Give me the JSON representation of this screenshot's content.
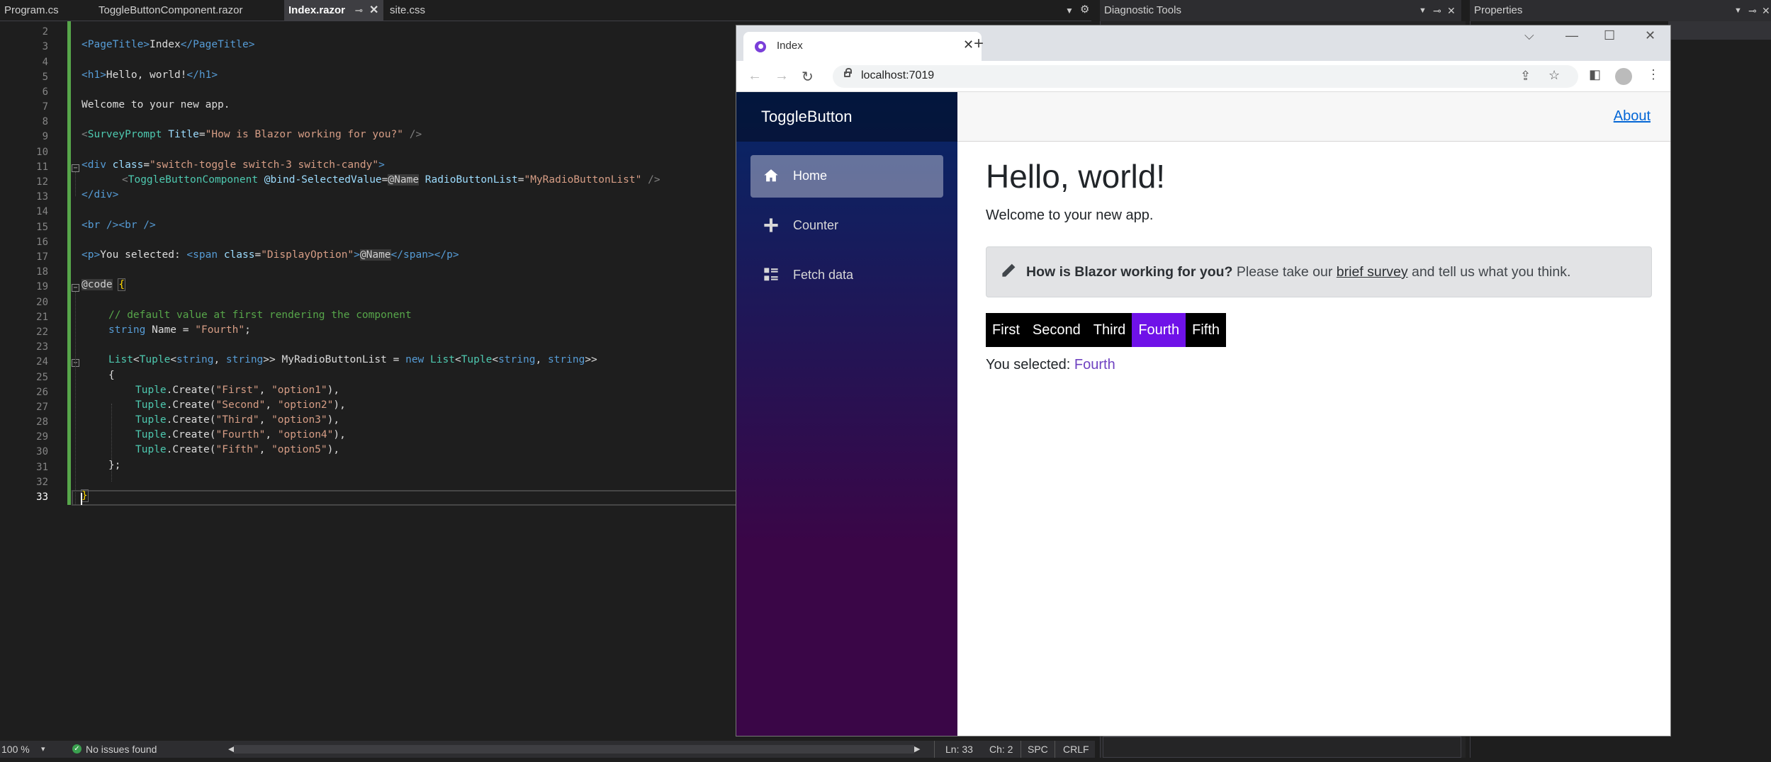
{
  "editor_tabs": [
    {
      "label": "Program.cs",
      "active": false
    },
    {
      "label": "ToggleButtonComponent.razor",
      "active": false
    },
    {
      "label": "Index.razor",
      "active": true
    },
    {
      "label": "site.css",
      "active": false
    }
  ],
  "line_numbers": [
    "2",
    "3",
    "4",
    "5",
    "6",
    "7",
    "8",
    "9",
    "10",
    "11",
    "12",
    "13",
    "14",
    "15",
    "16",
    "17",
    "18",
    "19",
    "20",
    "21",
    "22",
    "23",
    "24",
    "25",
    "26",
    "27",
    "28",
    "29",
    "30",
    "31",
    "32",
    "33"
  ],
  "code": {
    "l3": {
      "tag_open": "<PageTitle>",
      "text": "Index",
      "tag_close": "</PageTitle>"
    },
    "l5": {
      "tag_open": "<h1>",
      "text": "Hello, world!",
      "tag_close": "</h1>"
    },
    "l7": "Welcome to your new app.",
    "l9": {
      "open": "<",
      "comp": "SurveyPrompt",
      "attr": "Title",
      "eq": "=",
      "str": "\"How is Blazor working for you?\"",
      "close": " />"
    },
    "l11": {
      "open": "<div ",
      "attr": "class",
      "eq": "=",
      "str": "\"switch-toggle switch-3 switch-candy\"",
      "close": ">"
    },
    "l12": {
      "open": "<",
      "comp": "ToggleButtonComponent",
      "attr1": "@bind-SelectedValue",
      "eq1": "=",
      "val1": "@Name",
      "attr2": "RadioButtonList",
      "eq2": "=",
      "str2": "\"MyRadioButtonList\"",
      "close": " />"
    },
    "l13": "</div>",
    "l15": "<br /><br />",
    "l17": {
      "p_open": "<p>",
      "text": "You selected: ",
      "span_open": "<span ",
      "attr": "class",
      "eq": "=",
      "str": "\"DisplayOption\"",
      "gt": ">",
      "razor": "@Name",
      "span_close": "</span>",
      "p_close": "</p>"
    },
    "l19": {
      "razor": "@code",
      "brace": "{"
    },
    "l21": "// default value at first rendering the component",
    "l22": {
      "kw": "string",
      "rest": " Name = ",
      "str": "\"Fourth\"",
      "end": ";"
    },
    "l24": {
      "type1": "List",
      "p1": "<",
      "type2": "Tuple",
      "p2": "<",
      "kw1": "string",
      "p3": ", ",
      "kw2": "string",
      "p4": ">> MyRadioButtonList = ",
      "kw3": "new",
      "p5": " ",
      "type3": "List",
      "p6": "<",
      "type4": "Tuple",
      "p7": "<",
      "kw4": "string",
      "p8": ", ",
      "kw5": "string",
      "p9": ">>"
    },
    "l25": "{",
    "tuples": [
      {
        "type": "Tuple",
        "call": ".Create(",
        "a": "\"First\"",
        "sep": ", ",
        "b": "\"option1\"",
        "end": "),"
      },
      {
        "type": "Tuple",
        "call": ".Create(",
        "a": "\"Second\"",
        "sep": ", ",
        "b": "\"option2\"",
        "end": "),"
      },
      {
        "type": "Tuple",
        "call": ".Create(",
        "a": "\"Third\"",
        "sep": ", ",
        "b": "\"option3\"",
        "end": "),"
      },
      {
        "type": "Tuple",
        "call": ".Create(",
        "a": "\"Fourth\"",
        "sep": ", ",
        "b": "\"option4\"",
        "end": "),"
      },
      {
        "type": "Tuple",
        "call": ".Create(",
        "a": "\"Fifth\"",
        "sep": ", ",
        "b": "\"option5\"",
        "end": "),"
      }
    ],
    "l31": "};",
    "l33": "}"
  },
  "statusbar": {
    "zoom": "100 %",
    "issues": "No issues found",
    "ln": "Ln: 33",
    "ch": "Ch: 2",
    "spc": "SPC",
    "crlf": "CRLF"
  },
  "panels": {
    "diagnostic": "Diagnostic Tools",
    "properties": "Properties"
  },
  "browser": {
    "tab_title": "Index",
    "url": "localhost:7019",
    "app": {
      "brand": "ToggleButton",
      "nav": [
        {
          "label": "Home",
          "icon": "home-icon",
          "active": true
        },
        {
          "label": "Counter",
          "icon": "plus-icon",
          "active": false
        },
        {
          "label": "Fetch data",
          "icon": "list-icon",
          "active": false
        }
      ],
      "about": "About",
      "heading": "Hello, world!",
      "welcome": "Welcome to your new app.",
      "survey": {
        "bold": "How is Blazor working for you?",
        "pre": " Please take our ",
        "link": "brief survey",
        "post": " and tell us what you think."
      },
      "toggle_options": [
        "First",
        "Second",
        "Third",
        "Fourth",
        "Fifth"
      ],
      "selected_option": "Fourth",
      "you_selected_label": "You selected: ",
      "you_selected_value": "Fourth"
    }
  },
  "colors": {
    "accent": "#6f12e8",
    "sidebar_top": "#052767",
    "sidebar_bottom": "#3a0647",
    "change_bar": "#57a64a"
  }
}
